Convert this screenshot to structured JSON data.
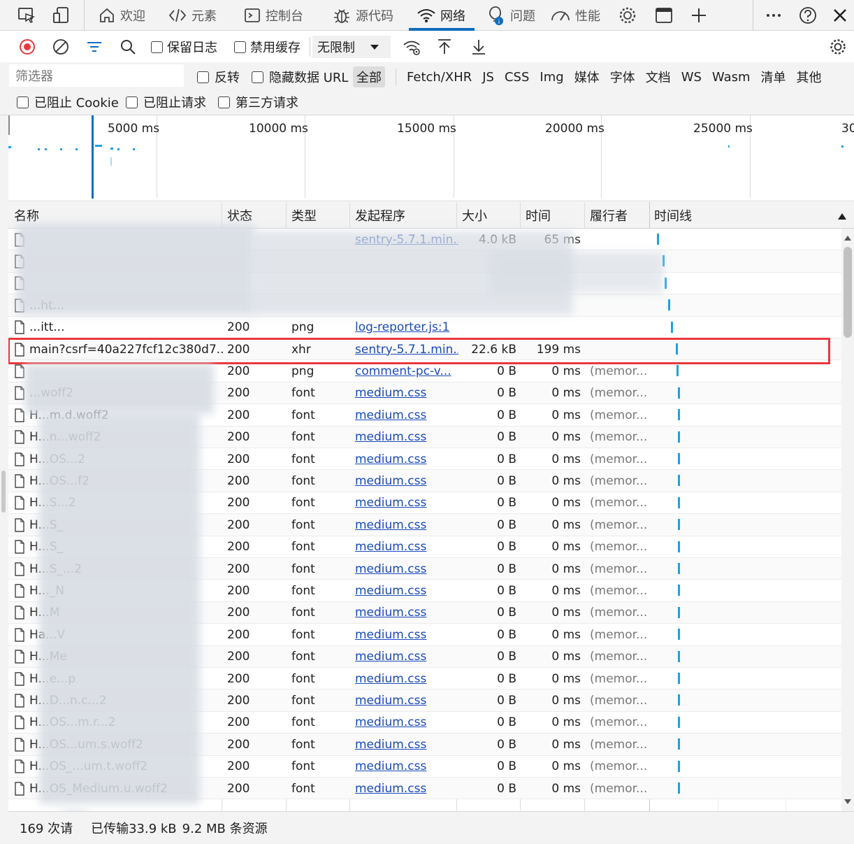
{
  "tabs": [
    {
      "label": "",
      "icon": "inspect-icon"
    },
    {
      "label": "",
      "icon": "device-emulation-icon"
    },
    {
      "label": "欢迎",
      "icon": "home-icon"
    },
    {
      "label": "元素",
      "icon": "code-icon"
    },
    {
      "label": "控制台",
      "icon": "console-icon"
    },
    {
      "label": "源代码",
      "icon": "bug-icon"
    },
    {
      "label": "网络",
      "icon": "wifi-icon",
      "active": true
    },
    {
      "label": "问题",
      "icon": "lightbulb-icon"
    },
    {
      "label": "性能",
      "icon": "gauge-icon"
    }
  ],
  "toolbar": {
    "preserve_log": "保留日志",
    "disable_cache": "禁用缓存",
    "throttle": "无限制"
  },
  "filters": {
    "placeholder": "筛选器",
    "invert": "反转",
    "hide_data_urls": "隐藏数据 URL",
    "types": [
      "全部",
      "Fetch/XHR",
      "JS",
      "CSS",
      "Img",
      "媒体",
      "字体",
      "文档",
      "WS",
      "Wasm",
      "清单",
      "其他"
    ],
    "blocked_cookies": "已阻止 Cookie",
    "blocked_requests": "已阻止请求",
    "third_party": "第三方请求"
  },
  "overview": {
    "ticks": [
      "5000 ms",
      "10000 ms",
      "15000 ms",
      "20000 ms",
      "25000 ms",
      "30"
    ]
  },
  "columns": {
    "name": "名称",
    "status": "状态",
    "type": "类型",
    "initiator": "发起程序",
    "size": "大小",
    "time": "时间",
    "fulfilled_by": "履行者",
    "waterfall": "时间线"
  },
  "rows": [
    {
      "name": "",
      "status": "",
      "type": "",
      "initiator": "sentry-5.7.1.min...",
      "size": "4.0 kB",
      "time": "65 ms",
      "ful": ""
    },
    {
      "name": "",
      "status": "",
      "type": "",
      "initiator": "",
      "size": "",
      "time": "",
      "ful": ""
    },
    {
      "name": "",
      "status": "",
      "type": "",
      "initiator": "",
      "size": "",
      "time": "",
      "ful": ""
    },
    {
      "name": "...ht...",
      "status": "",
      "type": "",
      "initiator": "",
      "size": "",
      "time": "",
      "ful": ""
    },
    {
      "name": "...itt...",
      "status": "200",
      "type": "png",
      "initiator": "log-reporter.js:1",
      "size": "",
      "time": "",
      "ful": ""
    },
    {
      "name": "main?csrf=40a227fcf12c380d7...",
      "status": "200",
      "type": "xhr",
      "initiator": "sentry-5.7.1.min...",
      "size": "22.6 kB",
      "time": "199 ms",
      "ful": ""
    },
    {
      "name": "",
      "status": "200",
      "type": "png",
      "initiator": "comment-pc-v...",
      "size": "0 B",
      "time": "0 ms",
      "ful": "(memor..."
    },
    {
      "name": "...woff2",
      "status": "200",
      "type": "font",
      "initiator": "medium.css",
      "size": "0 B",
      "time": "0 ms",
      "ful": "(memor..."
    },
    {
      "name": "H...m.d.woff2",
      "status": "200",
      "type": "font",
      "initiator": "medium.css",
      "size": "0 B",
      "time": "0 ms",
      "ful": "(memor..."
    },
    {
      "name": "H...n...woff2",
      "status": "200",
      "type": "font",
      "initiator": "medium.css",
      "size": "0 B",
      "time": "0 ms",
      "ful": "(memor..."
    },
    {
      "name": "H...OS...2",
      "status": "200",
      "type": "font",
      "initiator": "medium.css",
      "size": "0 B",
      "time": "0 ms",
      "ful": "(memor..."
    },
    {
      "name": "H...OS...f2",
      "status": "200",
      "type": "font",
      "initiator": "medium.css",
      "size": "0 B",
      "time": "0 ms",
      "ful": "(memor..."
    },
    {
      "name": "H...S...2",
      "status": "200",
      "type": "font",
      "initiator": "medium.css",
      "size": "0 B",
      "time": "0 ms",
      "ful": "(memor..."
    },
    {
      "name": "H...S_",
      "status": "200",
      "type": "font",
      "initiator": "medium.css",
      "size": "0 B",
      "time": "0 ms",
      "ful": "(memor..."
    },
    {
      "name": "H...S_",
      "status": "200",
      "type": "font",
      "initiator": "medium.css",
      "size": "0 B",
      "time": "0 ms",
      "ful": "(memor..."
    },
    {
      "name": "H...S_...2",
      "status": "200",
      "type": "font",
      "initiator": "medium.css",
      "size": "0 B",
      "time": "0 ms",
      "ful": "(memor..."
    },
    {
      "name": "H..._N",
      "status": "200",
      "type": "font",
      "initiator": "medium.css",
      "size": "0 B",
      "time": "0 ms",
      "ful": "(memor..."
    },
    {
      "name": "H...M",
      "status": "200",
      "type": "font",
      "initiator": "medium.css",
      "size": "0 B",
      "time": "0 ms",
      "ful": "(memor..."
    },
    {
      "name": "Ha...V",
      "status": "200",
      "type": "font",
      "initiator": "medium.css",
      "size": "0 B",
      "time": "0 ms",
      "ful": "(memor..."
    },
    {
      "name": "H...Me",
      "status": "200",
      "type": "font",
      "initiator": "medium.css",
      "size": "0 B",
      "time": "0 ms",
      "ful": "(memor..."
    },
    {
      "name": "H...e...p",
      "status": "200",
      "type": "font",
      "initiator": "medium.css",
      "size": "0 B",
      "time": "0 ms",
      "ful": "(memor..."
    },
    {
      "name": "H...D...n.c...2",
      "status": "200",
      "type": "font",
      "initiator": "medium.css",
      "size": "0 B",
      "time": "0 ms",
      "ful": "(memor..."
    },
    {
      "name": "H...OS...m.r...2",
      "status": "200",
      "type": "font",
      "initiator": "medium.css",
      "size": "0 B",
      "time": "0 ms",
      "ful": "(memor..."
    },
    {
      "name": "H...OS...um.s.woff2",
      "status": "200",
      "type": "font",
      "initiator": "medium.css",
      "size": "0 B",
      "time": "0 ms",
      "ful": "(memor..."
    },
    {
      "name": "H...OS_...um.t.woff2",
      "status": "200",
      "type": "font",
      "initiator": "medium.css",
      "size": "0 B",
      "time": "0 ms",
      "ful": "(memor..."
    },
    {
      "name": "H...OS_Medium.u.woff2",
      "status": "200",
      "type": "font",
      "initiator": "medium.css",
      "size": "0 B",
      "time": "0 ms",
      "ful": "(memor..."
    }
  ],
  "statusbar": {
    "requests": "169 次请",
    "transferred": "已传输33.9 kB",
    "resources": "9.2 MB 条资源"
  },
  "colors": {
    "accent": "#0f6cbd",
    "record": "#e8383d",
    "waterfall": "#1da1e5",
    "link": "#1a4ab8"
  }
}
